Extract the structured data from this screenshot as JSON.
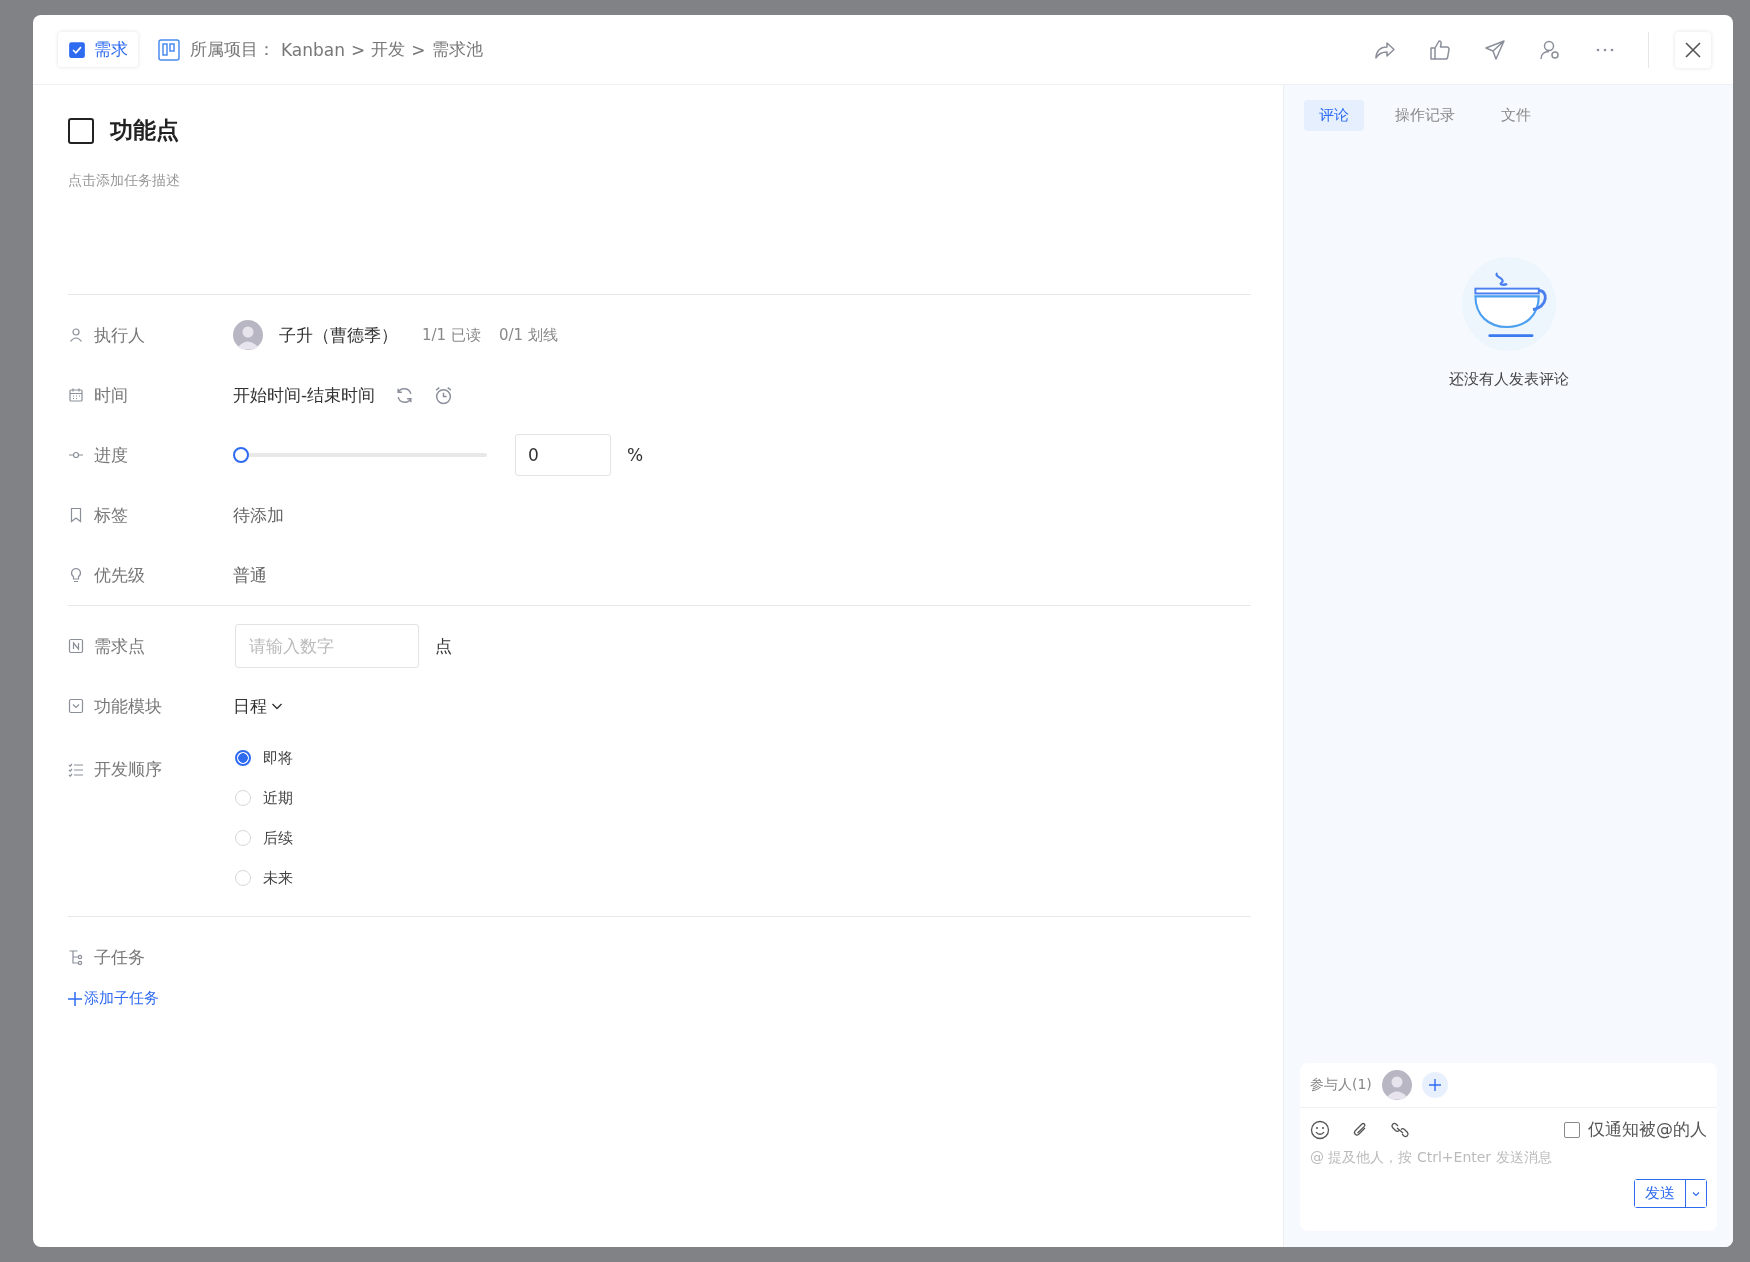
{
  "header": {
    "type_tag": "需求",
    "project_label": "所属项目：",
    "crumbs": [
      "Kanban",
      ">",
      "开发",
      ">",
      "需求池"
    ]
  },
  "task": {
    "done": false,
    "title": "功能点",
    "description_placeholder": "点击添加任务描述"
  },
  "fields": [
    {
      "kind": "assignee",
      "label": "执行人",
      "name": "子升（曹德季）",
      "read": "1/1 已读",
      "strike": "0/1 划线"
    },
    {
      "kind": "time",
      "label": "时间",
      "value": "开始时间-结束时间"
    },
    {
      "kind": "progress",
      "label": "进度",
      "level": 0,
      "value": "0",
      "unit": "%"
    },
    {
      "kind": "tags",
      "label": "标签",
      "value": "待添加"
    },
    {
      "kind": "priority",
      "label": "优先级",
      "value": "普通"
    }
  ],
  "custom_fields": [
    {
      "kind": "number",
      "label": "需求点",
      "placeholder": "请输入数字",
      "unit": "点"
    },
    {
      "kind": "select",
      "label": "功能模块",
      "value": "日程"
    },
    {
      "kind": "radio",
      "label": "开发顺序",
      "options": [
        {
          "label": "即将",
          "selected": true
        },
        {
          "label": "近期",
          "selected": false
        },
        {
          "label": "后续",
          "selected": false
        },
        {
          "label": "未来",
          "selected": false
        }
      ]
    }
  ],
  "subtasks": {
    "label": "子任务",
    "add": "添加子任务"
  },
  "comments_panel": {
    "tabs": [
      {
        "label": "评论",
        "selected": true
      },
      {
        "label": "操作记录",
        "selected": false
      },
      {
        "label": "文件",
        "selected": false
      }
    ],
    "empty_text": "还没有人发表评论",
    "participants_label": "参与人(1)",
    "notify_only_mentioned": {
      "label": "仅通知被@的人",
      "checked": false
    },
    "input_placeholder": "@ 提及他人，按 Ctrl+Enter 发送消息",
    "send": "发送"
  }
}
